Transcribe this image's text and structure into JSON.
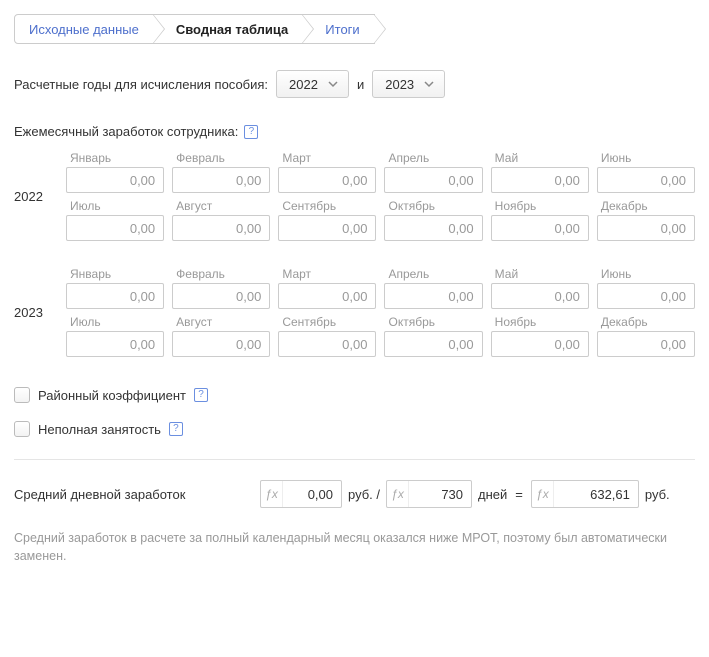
{
  "steps": {
    "source": "Исходные данные",
    "summary": "Сводная таблица",
    "totals": "Итоги"
  },
  "calc_years": {
    "label": "Расчетные годы для исчисления пособия:",
    "year1": "2022",
    "and": "и",
    "year2": "2023"
  },
  "earnings": {
    "label": "Ежемесячный заработок сотрудника:",
    "year_a": "2022",
    "year_b": "2023",
    "months": {
      "jan": "Январь",
      "feb": "Февраль",
      "mar": "Март",
      "apr": "Апрель",
      "may": "Май",
      "jun": "Июнь",
      "jul": "Июль",
      "aug": "Август",
      "sep": "Сентябрь",
      "oct": "Октябрь",
      "nov": "Ноябрь",
      "dec": "Декабрь"
    },
    "zero": "0,00"
  },
  "options": {
    "district_coeff": "Районный коэффициент",
    "part_time": "Неполная занятость"
  },
  "result": {
    "label": "Средний дневной заработок",
    "amount": "0,00",
    "unit_rub_per": "руб. /",
    "days": "730",
    "unit_days": "дней",
    "equals": "=",
    "total": "632,61",
    "unit_rub": "руб."
  },
  "note": "Средний заработок в расчете за полный календарный месяц оказался ниже МРОТ, поэтому был автоматически заменен."
}
